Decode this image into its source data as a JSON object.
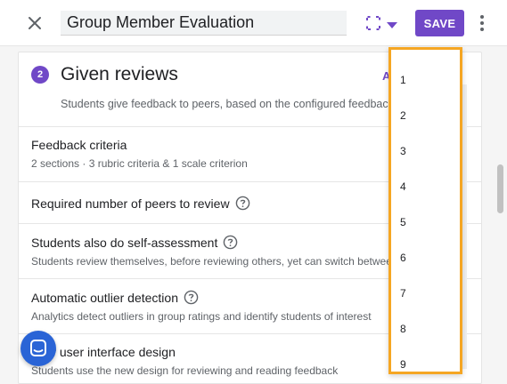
{
  "header": {
    "title_value": "Group Member Evaluation",
    "save_label": "SAVE"
  },
  "section": {
    "step_number": "2",
    "title": "Given reviews",
    "advanced_peek": "A",
    "description": "Students give feedback to peers, based on the configured feedback crit"
  },
  "rows": {
    "feedback_criteria": {
      "label": "Feedback criteria",
      "sub": "2 sections · 3 rubric criteria & 1 scale criterion"
    },
    "required_peers": {
      "label": "Required number of peers to review"
    },
    "self_assessment": {
      "label": "Students also do self-assessment",
      "sub": "Students review themselves, before reviewing others, yet can switch between"
    },
    "outlier_detection": {
      "label": "Automatic outlier detection",
      "sub": "Analytics detect outliers in group ratings and identify students of interest"
    },
    "new_ui": {
      "label": "New user interface design",
      "sub": "Students use the new design for reviewing and reading feedback"
    }
  },
  "dropdown": {
    "options": [
      "1",
      "2",
      "3",
      "4",
      "5",
      "6",
      "7",
      "8",
      "9"
    ]
  },
  "colors": {
    "accent": "#7048c7",
    "dropdown_highlight": "#f5a623",
    "chat_fab": "#2a64d6"
  },
  "icons": {
    "close": "close-icon",
    "expand": "fullscreen-icon",
    "caret": "caret-down-icon",
    "more": "more-vert-icon",
    "help": "help-circle-icon",
    "chat": "chat-icon"
  }
}
